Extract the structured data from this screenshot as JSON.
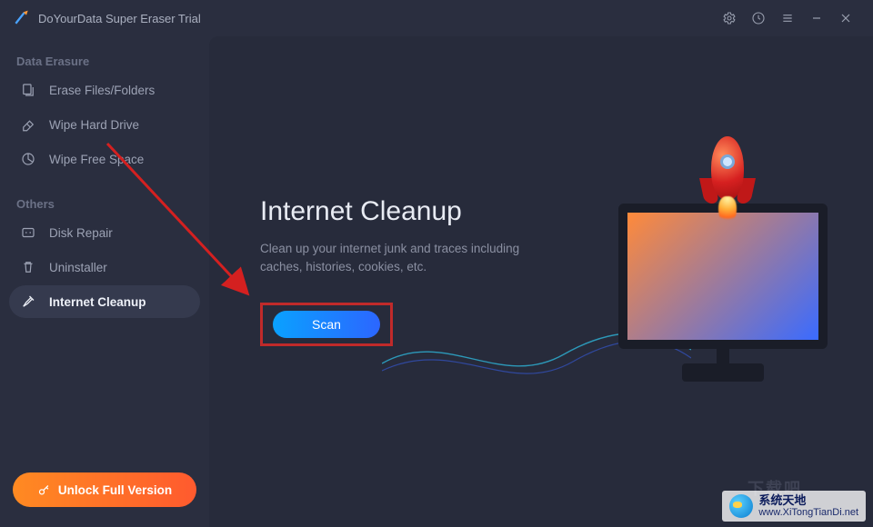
{
  "app": {
    "title": "DoYourData Super Eraser Trial"
  },
  "sidebar": {
    "section1_header": "Data Erasure",
    "section2_header": "Others",
    "items": [
      {
        "label": "Erase Files/Folders"
      },
      {
        "label": "Wipe Hard Drive"
      },
      {
        "label": "Wipe Free Space"
      },
      {
        "label": "Disk Repair"
      },
      {
        "label": "Uninstaller"
      },
      {
        "label": "Internet Cleanup"
      }
    ],
    "unlock_label": "Unlock Full Version"
  },
  "main": {
    "title": "Internet Cleanup",
    "desc_line1": "Clean up your internet junk and traces including",
    "desc_line2": "caches, histories, cookies, etc.",
    "scan_label": "Scan"
  },
  "watermark": {
    "dark_tag": "下载吧",
    "brand": "系统天地",
    "url": "www.XiTongTianDi.net"
  }
}
